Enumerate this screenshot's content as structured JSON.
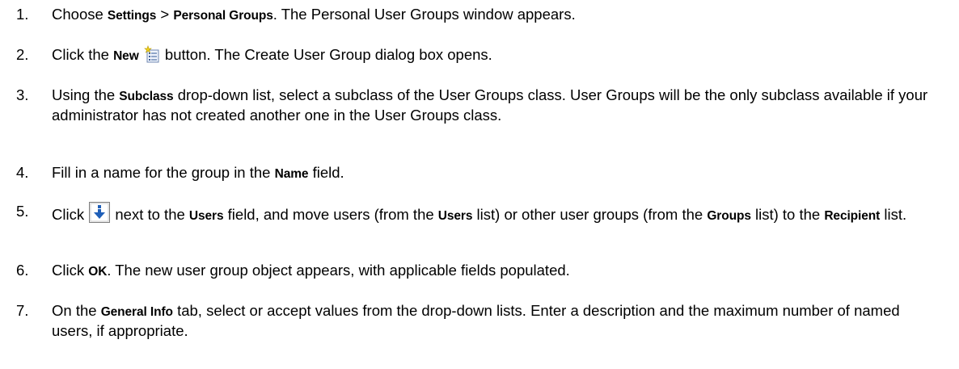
{
  "steps": [
    {
      "number": "1.",
      "parts": [
        {
          "t": "Choose "
        },
        {
          "b": "Settings"
        },
        {
          "t": " > "
        },
        {
          "b": "Personal Groups"
        },
        {
          "t": ". The Personal User Groups window appears."
        }
      ]
    },
    {
      "number": "2.",
      "parts": [
        {
          "t": "Click the "
        },
        {
          "b": "New"
        },
        {
          "t": " "
        },
        {
          "icon": "new-document-icon"
        },
        {
          "t": " button. The Create User Group dialog box opens."
        }
      ]
    },
    {
      "number": "3.",
      "parts": [
        {
          "t": "Using the "
        },
        {
          "b": "Subclass"
        },
        {
          "t": " drop-down list, select a subclass of the User Groups class. User Groups will be the only subclass available if your administrator has not created another one in the User Groups class."
        }
      ]
    },
    {
      "number": "4.",
      "parts": [
        {
          "t": "Fill in a name for the group in the "
        },
        {
          "b": "Name"
        },
        {
          "t": " field."
        }
      ]
    },
    {
      "number": "5.",
      "parts": [
        {
          "t": "Click "
        },
        {
          "icon": "down-arrow-icon"
        },
        {
          "t": " next to the "
        },
        {
          "b": "Users"
        },
        {
          "t": " field, and move users (from the "
        },
        {
          "b": "Users"
        },
        {
          "t": " list) or other user groups (from the "
        },
        {
          "b": "Groups"
        },
        {
          "t": " list) to the "
        },
        {
          "b": "Recipient"
        },
        {
          "t": " list."
        }
      ]
    },
    {
      "number": "6.",
      "parts": [
        {
          "t": "Click "
        },
        {
          "b": "OK"
        },
        {
          "t": ". The new user group object appears, with applicable fields populated."
        }
      ]
    },
    {
      "number": "7.",
      "parts": [
        {
          "t": "On the "
        },
        {
          "b": "General Info"
        },
        {
          "t": " tab, select or accept values from the drop-down lists. Enter a description and the maximum number of named users, if appropriate."
        }
      ]
    }
  ]
}
